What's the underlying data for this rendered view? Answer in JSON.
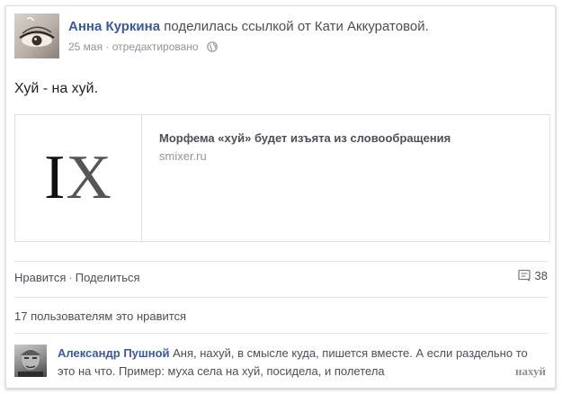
{
  "post": {
    "author": "Анна Куркина",
    "shared_text": " поделилась ссылкой от Кати Аккуратовой.",
    "date": "25 мая",
    "edited": " · отредактировано",
    "text": "Хуй - на хуй."
  },
  "link": {
    "thumb_letter_1": "I",
    "thumb_letter_2": "X",
    "title": "Морфема «хуй» будет изъята из словообращения",
    "domain": "smixer.ru"
  },
  "actions": {
    "like": "Нравится",
    "separator": "·",
    "share": "Поделиться",
    "comment_count": "38"
  },
  "likes_summary": "17 пользователям это нравится",
  "comment": {
    "author": "Александр Пушной",
    "text": " Аня, нахуй, в смысле куда, пишется вместе. А если раздельно то это на что. Пример: муха села на хуй, посидела, и полетела"
  },
  "watermark": "нахуй",
  "colors": {
    "link_blue": "#3b5998",
    "text_gray": "#4b4f56",
    "meta_gray": "#90949c"
  }
}
